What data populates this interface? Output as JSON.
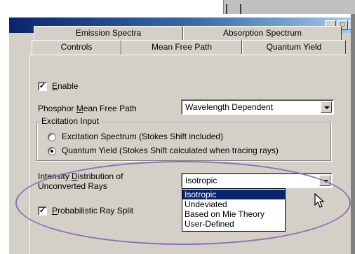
{
  "window": {
    "min_label": "_",
    "max_label": "□"
  },
  "tabs": {
    "back_row": [
      "Emission Spectra",
      "Absorption Spectrum"
    ],
    "front_row": [
      "Controls",
      "Mean Free Path",
      "Quantum Yield"
    ],
    "active": "Controls"
  },
  "controls": {
    "enable": {
      "label": "Enable",
      "mnemonic": "E",
      "rest": "nable",
      "checked": true
    },
    "phosphor_mfp": {
      "label_pre": "Phosphor ",
      "mnemonic": "M",
      "label_post": "ean Free Path",
      "value": "Wavelength Dependent"
    },
    "excitation_group": {
      "title": "Excitation Input",
      "options": [
        "Excitation Spectrum (Stokes Shift included)",
        "Quantum Yield (Stokes Shift calculated when tracing rays)"
      ],
      "selected_index": 1
    },
    "intensity": {
      "label_line1_pre": "Intensity ",
      "mnemonic": "D",
      "label_line1_post": "istribution of",
      "label_line2": "Unconverted Rays",
      "value": "Isotropic",
      "options": [
        "Isotropic",
        "Undeviated",
        "Based on Mie Theory",
        "User-Defined"
      ],
      "highlighted_index": 0
    },
    "ray_split": {
      "mnemonic": "P",
      "rest": "robabilistic Ray Split",
      "checked": true
    }
  },
  "colors": {
    "dialog_bg": "#d4d0c8",
    "title_start": "#0a246a",
    "title_end": "#a6caf0",
    "selection": "#0a246a",
    "annotation": "#8a6fb4"
  }
}
